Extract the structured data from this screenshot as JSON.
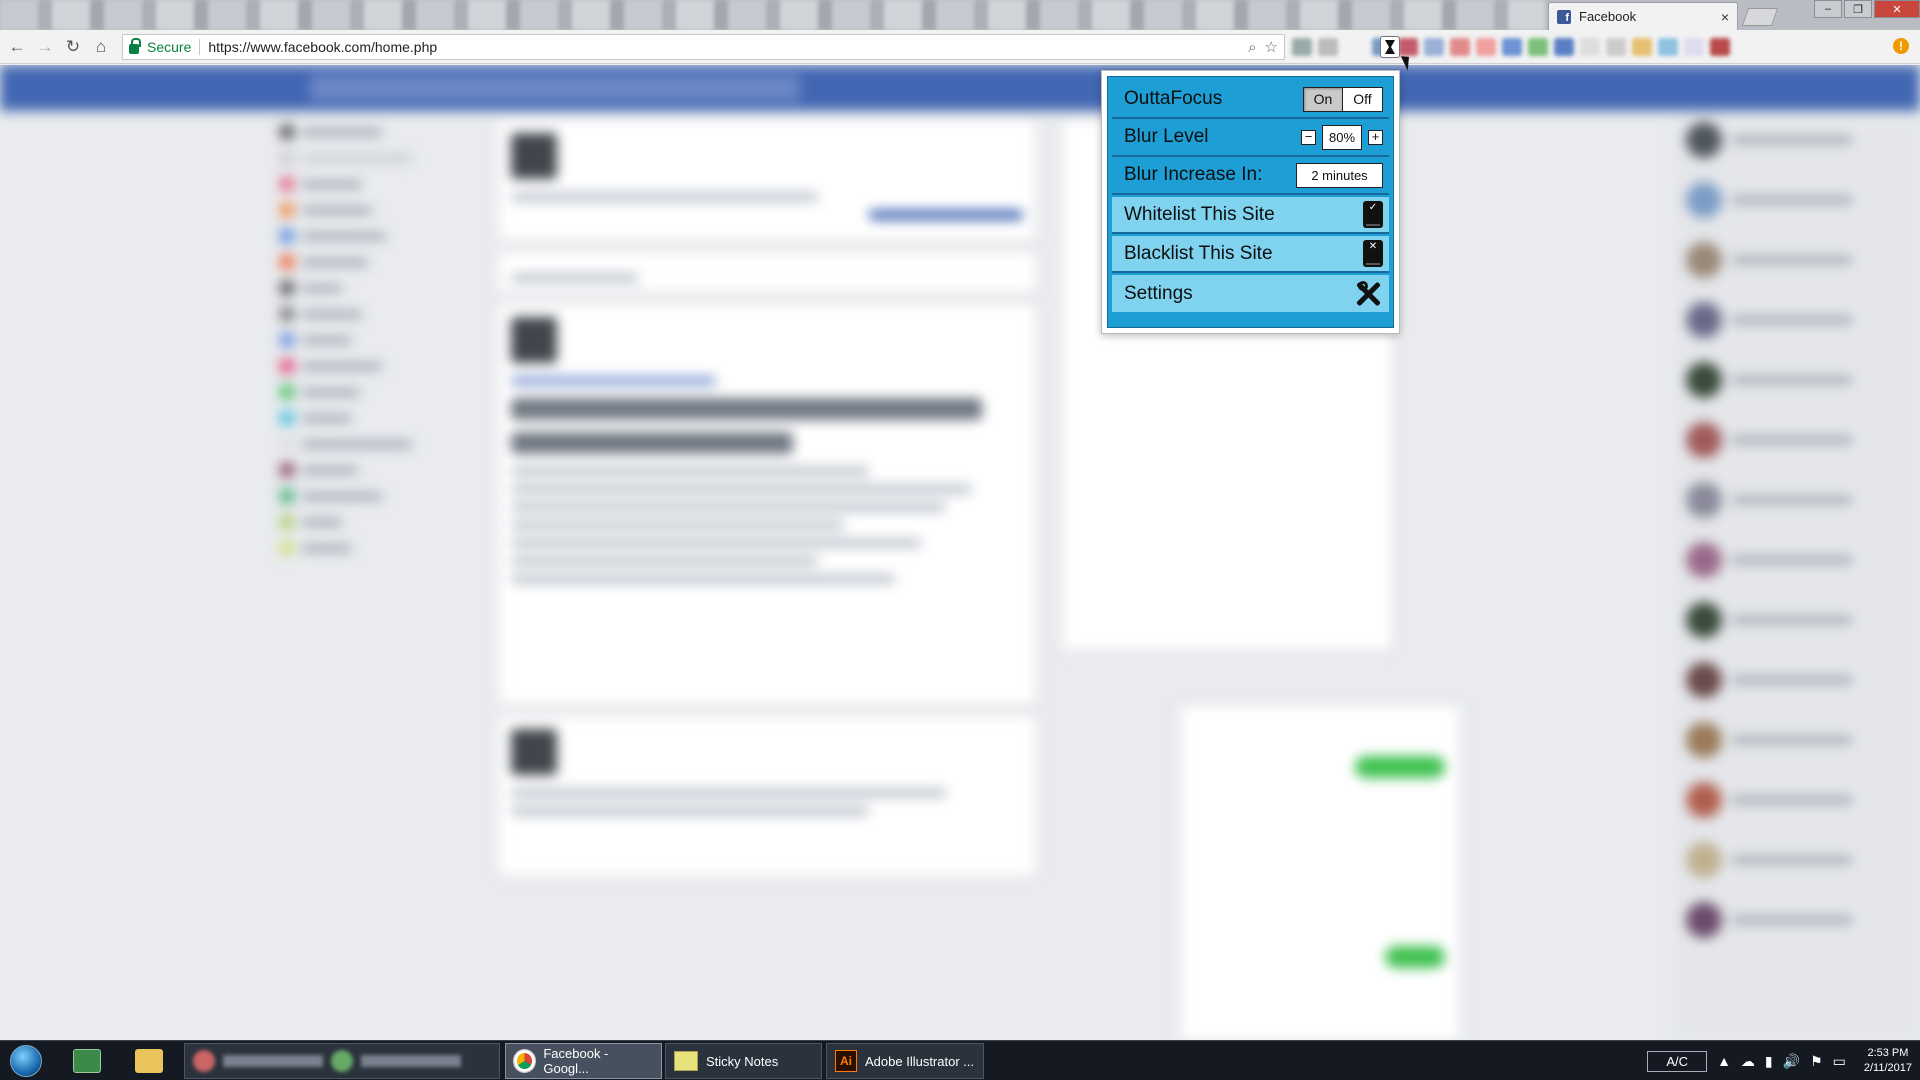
{
  "browser": {
    "active_tab_title": "Facebook",
    "active_tab_favicon": "f",
    "tab_close": "×",
    "win_min": "–",
    "win_max": "❐",
    "win_close": "✕",
    "secure_label": "Secure",
    "url": "https://www.facebook.com/home.php",
    "icons": {
      "back": "←",
      "forward": "→",
      "reload": "↻",
      "home": "⌂",
      "zoom": "⌕",
      "star": "☆",
      "menu": "!"
    }
  },
  "popup": {
    "title": "OuttaFocus",
    "toggle_on": "On",
    "toggle_off": "Off",
    "blur_label": "Blur Level",
    "blur_minus": "−",
    "blur_value": "80%",
    "blur_plus": "+",
    "increase_label": "Blur Increase In:",
    "increase_value": "2 minutes",
    "whitelist_label": "Whitelist This Site",
    "whitelist_mark": "✓",
    "blacklist_label": "Blacklist This Site",
    "blacklist_mark": "✕",
    "settings_label": "Settings"
  },
  "taskbar": {
    "tasks": [
      {
        "label": "Facebook - Googl..."
      },
      {
        "label": "Sticky Notes"
      },
      {
        "label": "Adobe Illustrator ..."
      }
    ],
    "ai_icon_text": "Ai",
    "ac_label": "A/C",
    "time": "2:53 PM",
    "date": "2/11/2017",
    "tray_icons": [
      "▲",
      "☁",
      "▮",
      "🔊",
      "⚑",
      "▭"
    ]
  },
  "colors": {
    "popup_bg": "#1d9fd6",
    "popup_button": "#7fd3ef",
    "fb_blue": "#4267b2"
  }
}
